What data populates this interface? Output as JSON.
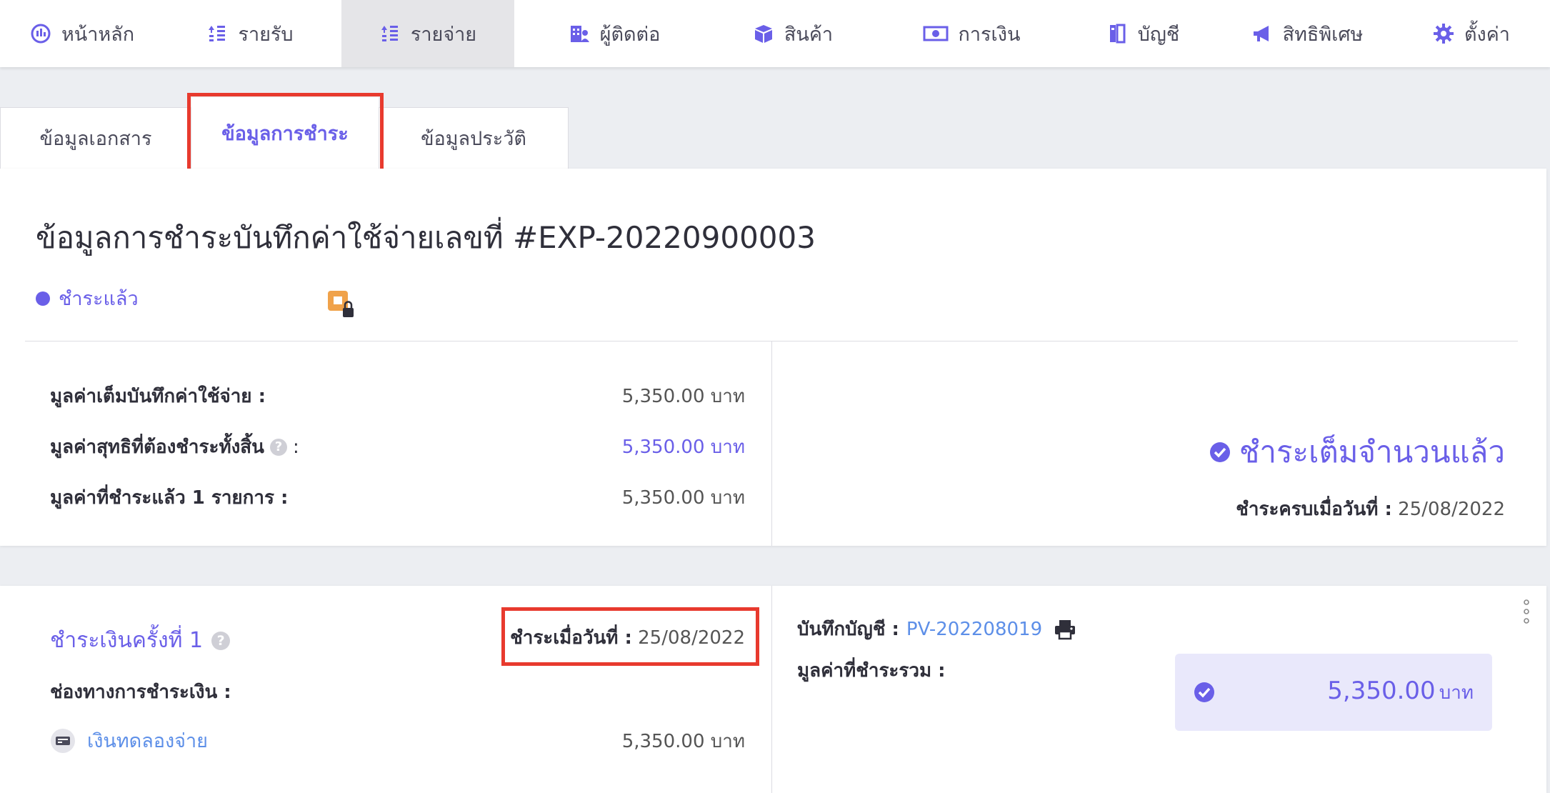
{
  "nav": {
    "items": [
      {
        "label": "หน้าหลัก",
        "icon": "dashboard-icon"
      },
      {
        "label": "รายรับ",
        "icon": "income-icon"
      },
      {
        "label": "รายจ่าย",
        "icon": "expense-icon"
      },
      {
        "label": "ผู้ติดต่อ",
        "icon": "contacts-icon"
      },
      {
        "label": "สินค้า",
        "icon": "product-box-icon"
      },
      {
        "label": "การเงิน",
        "icon": "money-icon"
      },
      {
        "label": "บัญชี",
        "icon": "accounting-book-icon"
      },
      {
        "label": "สิทธิพิเศษ",
        "icon": "megaphone-icon"
      },
      {
        "label": "ตั้งค่า",
        "icon": "gear-icon"
      }
    ],
    "active_index": 2
  },
  "tabs": [
    {
      "label": "ข้อมูลเอกสาร"
    },
    {
      "label": "ข้อมูลการชำระ"
    },
    {
      "label": "ข้อมูลประวัติ"
    }
  ],
  "summary": {
    "title": "ข้อมูลการชำระบันทึกค่าใช้จ่ายเลขที่ #EXP-20220900003",
    "status": "ชำระแล้ว",
    "status_color": "#6a5fe8",
    "rows": [
      {
        "label": "มูลค่าเต็มบันทึกค่าใช้จ่าย :",
        "value": "5,350.00 บาท"
      },
      {
        "label": "มูลค่าสุทธิที่ต้องชำระทั้งสิ้น",
        "label_suffix": ":",
        "value": "5,350.00 บาท"
      },
      {
        "label": "มูลค่าที่ชำระแล้ว 1 รายการ :",
        "value": "5,350.00 บาท"
      }
    ],
    "paid_full": "ชำระเต็มจำนวนแล้ว",
    "paid_date_label": "ชำระครบเมื่อวันที่ :",
    "paid_date": "25/08/2022"
  },
  "payment": {
    "title": "ชำระเงินครั้งที่ 1",
    "date_label": "ชำระเมื่อวันที่ :",
    "date": "25/08/2022",
    "channel_label": "ช่องทางการชำระเงิน :",
    "channel_name": "เงินทดลองจ่าย",
    "channel_amount": "5,350.00 บาท",
    "journal_label": "บันทึกบัญชี :",
    "journal_ref": "PV-202208019",
    "total_label": "มูลค่าที่ชำระรวม :",
    "total_amount": "5,350.00",
    "total_unit": "บาท"
  },
  "colors": {
    "accent": "#6a5fe8",
    "highlight": "#e83a2e",
    "link": "#5d8fe8",
    "badge": "#f0a24a",
    "total_bg": "#e9e8fb"
  }
}
